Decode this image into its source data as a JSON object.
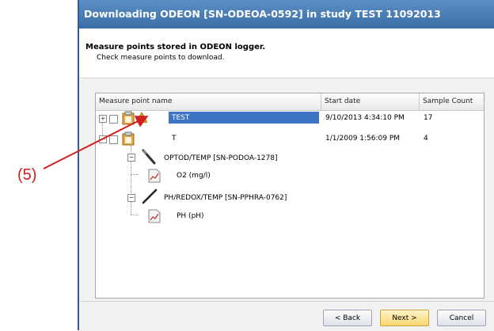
{
  "dialog": {
    "title": "Downloading ODEON [SN-ODEOA-0592] in study TEST 11092013",
    "heading": "Measure points stored in ODEON logger.",
    "subheading": "Check measure points to download."
  },
  "table": {
    "columns": [
      "Measure point name",
      "Start date",
      "Sample Count"
    ],
    "rows": [
      {
        "name": "TEST",
        "start_date": "9/10/2013 4:34:10 PM",
        "count": "17",
        "selected": true
      },
      {
        "name": "T",
        "start_date": "1/1/2009 1:56:09 PM",
        "count": "4",
        "selected": false
      }
    ],
    "sensors": [
      {
        "name": "OPTOD/TEMP [SN-PODOA-1278]",
        "parameter": "O2 (mg/l)"
      },
      {
        "name": "PH/REDOX/TEMP [SN-PPHRA-0762]",
        "parameter": "PH (pH)"
      }
    ]
  },
  "buttons": {
    "back": "< Back",
    "next": "Next >",
    "cancel": "Cancel"
  },
  "annotation": {
    "label": "(5)",
    "color": "#d02020"
  },
  "colors": {
    "titlebar": "#4a7db8",
    "selection": "#3f74c4"
  },
  "icons": [
    "clipboard-icon",
    "warning-icon",
    "probe-icon",
    "chart-icon",
    "expand-icon",
    "collapse-icon"
  ]
}
